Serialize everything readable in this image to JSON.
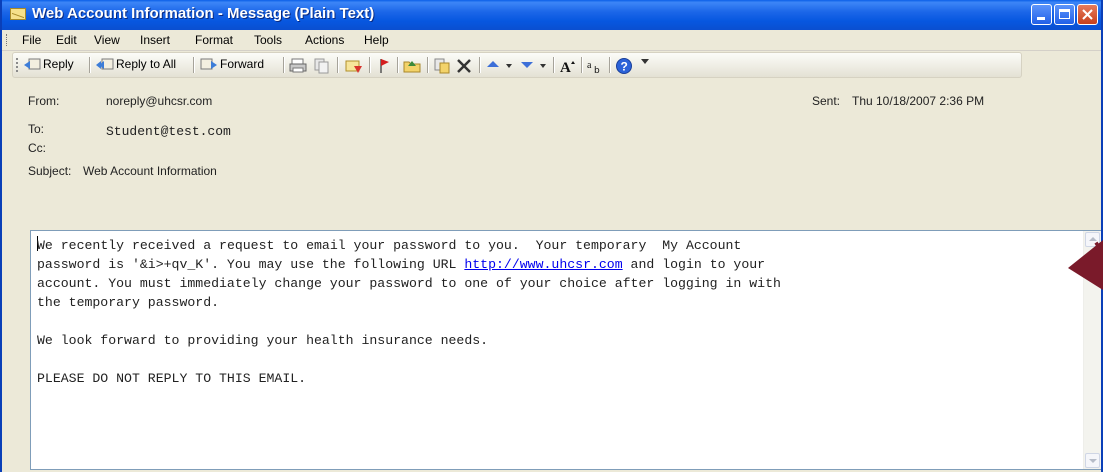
{
  "window": {
    "title": "Web Account Information - Message (Plain Text)"
  },
  "menu": {
    "items": [
      "File",
      "Edit",
      "View",
      "Insert",
      "Format",
      "Tools",
      "Actions",
      "Help"
    ]
  },
  "toolbar": {
    "reply_label": "Reply",
    "reply_all_label": "Reply to All",
    "forward_label": "Forward",
    "icons": [
      "print-icon",
      "copy-icon",
      "move-icon",
      "flag-icon",
      "folder-icon",
      "categorize-icon",
      "delete-icon",
      "previous-item-icon",
      "next-item-icon",
      "font-size-icon",
      "encoding-icon",
      "help-icon"
    ]
  },
  "header": {
    "from_label": "From:",
    "from_value": "noreply@uhcsr.com",
    "sent_label": "Sent:",
    "sent_value": "Thu 10/18/2007 2:36 PM",
    "to_label": "To:",
    "to_value": "Student@test.com",
    "cc_label": "Cc:",
    "cc_value": "",
    "subject_label": "Subject:",
    "subject_value": "Web Account Information"
  },
  "body": {
    "line1_caret_char": "W",
    "line1_rest": "e recently received a request to email your password to you.  Your temporary  My Account",
    "line2_before": "password is '&i>+qv_K'. You may use the following URL ",
    "link": "http://www.uhcsr.com",
    "line2_after": " and login to your",
    "line3": "account. You must immediately change your password to one of your choice after logging in with",
    "line4": "the temporary password.",
    "line5": "We look forward to providing your health insurance needs.",
    "line6": "PLEASE DO NOT REPLY TO THIS EMAIL."
  },
  "colors": {
    "titlebar": "#0a5fe8",
    "chrome": "#ece9d8",
    "link": "#0000ee",
    "annotation_arrow": "#7a1a2a"
  }
}
